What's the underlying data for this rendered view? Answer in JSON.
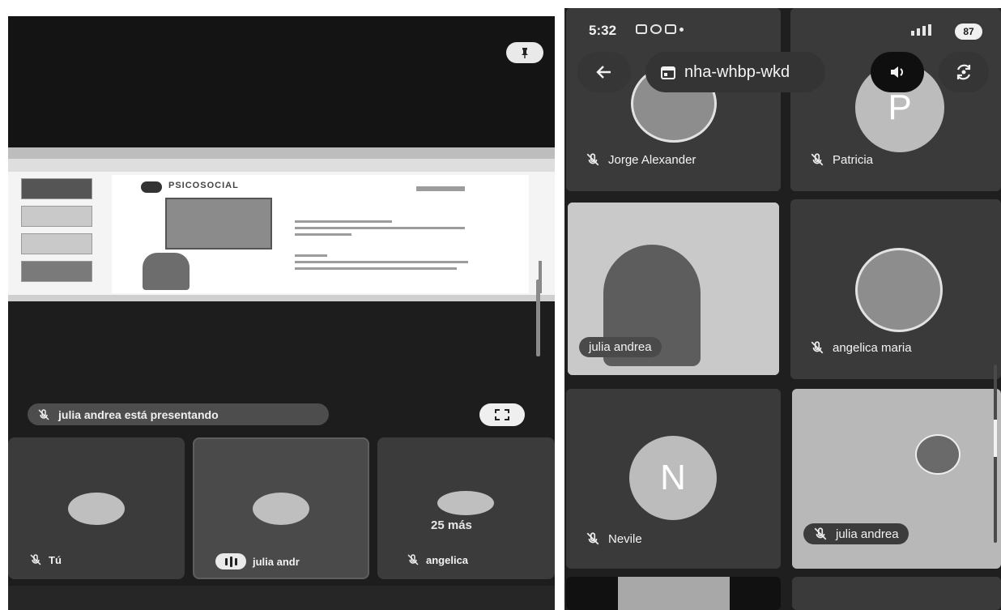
{
  "left_panel": {
    "slide": {
      "deck_title": "PSICOSOCIAL"
    },
    "presenting_label": "julia andrea está presentando",
    "tiles": [
      {
        "label": "Tú",
        "muted": true
      },
      {
        "label": "julia andr",
        "speaking": true
      },
      {
        "label": "angelica",
        "muted": true,
        "overflow_count": "25 más"
      }
    ]
  },
  "right_panel": {
    "status_bar": {
      "time": "5:32",
      "battery": "87"
    },
    "toolbar": {
      "meeting_code": "nha-whbp-wkd"
    },
    "participants": [
      {
        "name": "Jorge Alexander",
        "muted": true
      },
      {
        "name": "Patricia",
        "muted": true,
        "initial": "P"
      },
      {
        "name": "julia andrea",
        "muted": false,
        "camera_on": true
      },
      {
        "name": "angelica maria",
        "muted": true
      },
      {
        "name": "Nevile",
        "muted": true,
        "initial": "N"
      },
      {
        "name": "julia andrea",
        "muted": true
      }
    ]
  },
  "colors": {
    "panel_dark": "#1f1f1f",
    "tile": "#3a3a3a",
    "chip": "#343434",
    "light_button": "#efefef"
  },
  "icons": [
    "pin-icon",
    "mic-off-icon",
    "fullscreen-icon",
    "speaking-icon",
    "arrow-back-icon",
    "calendar-icon",
    "speaker-icon",
    "camera-flip-icon",
    "wifi-icon",
    "battery-icon"
  ]
}
